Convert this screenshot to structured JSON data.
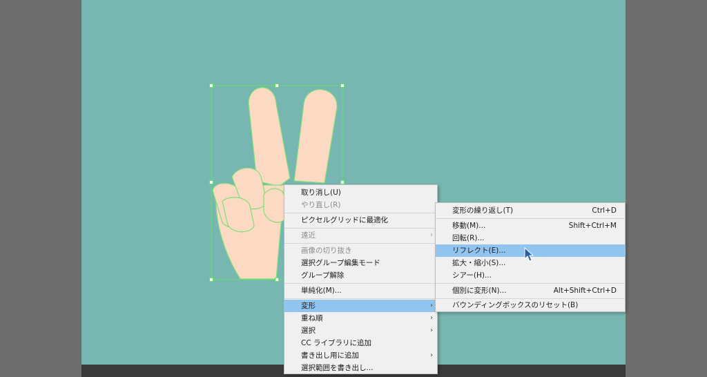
{
  "context_menu": {
    "items": [
      {
        "label": "取り消し(U)",
        "enabled": true
      },
      {
        "label": "やり直し(R)",
        "enabled": false
      },
      {
        "label": "ピクセルグリッドに最適化",
        "enabled": true
      },
      {
        "label": "遠近",
        "enabled": false,
        "submenu": true
      },
      {
        "label": "画像の切り抜き",
        "enabled": false
      },
      {
        "label": "選択グループ編集モード",
        "enabled": true
      },
      {
        "label": "グループ解除",
        "enabled": true
      },
      {
        "label": "単純化(M)...",
        "enabled": true
      },
      {
        "label": "変形",
        "enabled": true,
        "submenu": true,
        "highlighted": true
      },
      {
        "label": "重ね順",
        "enabled": true,
        "submenu": true
      },
      {
        "label": "選択",
        "enabled": true,
        "submenu": true
      },
      {
        "label": "CC ライブラリに追加",
        "enabled": true
      },
      {
        "label": "書き出し用に追加",
        "enabled": true,
        "submenu": true
      },
      {
        "label": "選択範囲を書き出し...",
        "enabled": true
      }
    ]
  },
  "transform_submenu": {
    "items": [
      {
        "label": "変形の繰り返し(T)",
        "shortcut": "Ctrl+D"
      },
      {
        "label": "移動(M)...",
        "shortcut": "Shift+Ctrl+M"
      },
      {
        "label": "回転(R)...",
        "shortcut": ""
      },
      {
        "label": "リフレクト(E)...",
        "shortcut": "",
        "highlighted": true
      },
      {
        "label": "拡大・縮小(S)...",
        "shortcut": ""
      },
      {
        "label": "シアー(H)...",
        "shortcut": ""
      },
      {
        "label": "個別に変形(N)...",
        "shortcut": "Alt+Shift+Ctrl+D"
      },
      {
        "label": "バウンディングボックスのリセット(B)",
        "shortcut": ""
      }
    ]
  },
  "colors": {
    "canvas": "#78b6b1",
    "highlight": "#92c4f0",
    "hand_fill": "#fbd9c3",
    "selection": "#66e066"
  }
}
